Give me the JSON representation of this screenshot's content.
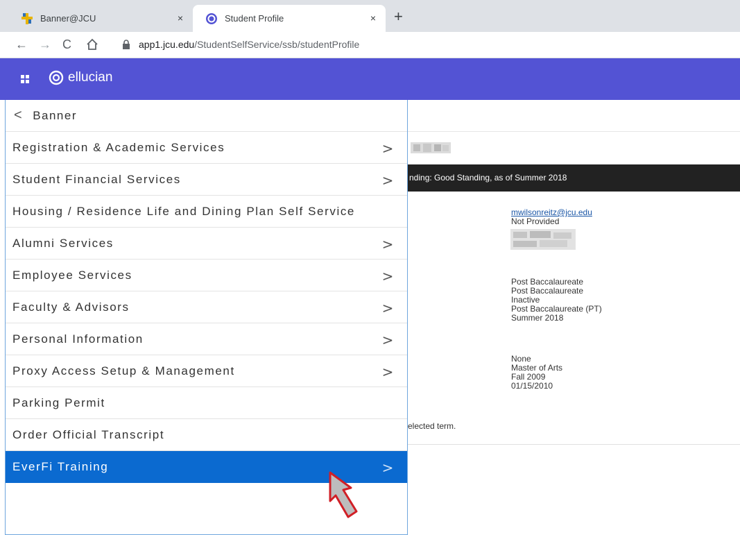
{
  "browser": {
    "tabs": [
      {
        "title": "Banner@JCU",
        "active": false
      },
      {
        "title": "Student Profile",
        "active": true
      }
    ],
    "new_tab": "+",
    "close_glyph": "×",
    "url_host": "app1.jcu.edu",
    "url_path": "/StudentSelfService/ssb/studentProfile"
  },
  "app": {
    "brand": "ellucian",
    "accent_color": "#5353d4"
  },
  "menu": {
    "back_label": "Banner",
    "items": [
      {
        "label": "Registration & Academic Services",
        "has_submenu": true
      },
      {
        "label": "Student Financial Services",
        "has_submenu": true
      },
      {
        "label": "Housing / Residence Life and Dining Plan Self Service",
        "has_submenu": false
      },
      {
        "label": "Alumni Services",
        "has_submenu": true
      },
      {
        "label": "Employee Services",
        "has_submenu": true
      },
      {
        "label": "Faculty & Advisors",
        "has_submenu": true
      },
      {
        "label": "Personal Information",
        "has_submenu": true
      },
      {
        "label": "Proxy Access Setup & Management",
        "has_submenu": true
      },
      {
        "label": "Parking Permit",
        "has_submenu": false
      },
      {
        "label": "Order Official Transcript",
        "has_submenu": false
      },
      {
        "label": "EverFi Training",
        "has_submenu": true,
        "active": true
      }
    ],
    "active_color": "#0b6ad0"
  },
  "profile": {
    "standing_text": "nding: Good Standing, as of Summer 2018",
    "email": "mwilsonreitz@jcu.edu",
    "phone": "Not Provided",
    "curriculum": [
      "Post Baccalaureate",
      "Post Baccalaureate",
      "Inactive",
      "Post Baccalaureate (PT)",
      "Summer 2018"
    ],
    "graduation": [
      "None",
      "Master of Arts",
      "Fall 2009",
      "01/15/2010"
    ],
    "footer_text": "elected term."
  }
}
